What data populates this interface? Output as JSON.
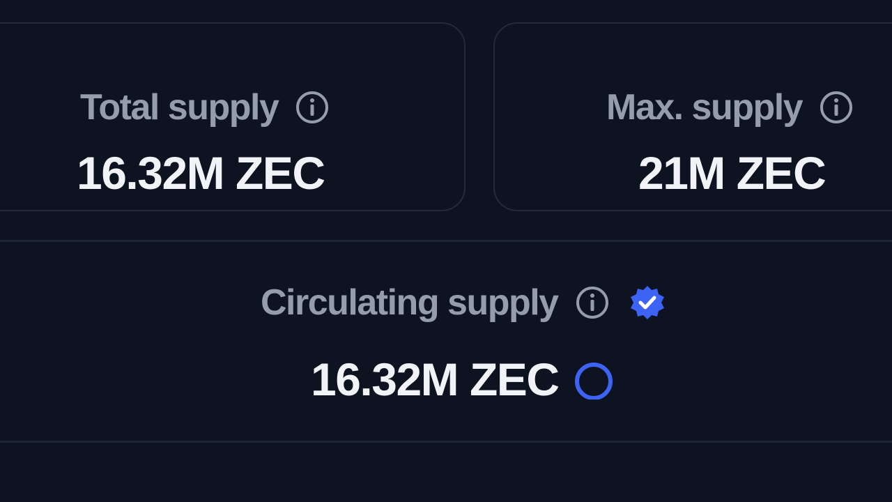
{
  "supply_cards": {
    "total": {
      "label": "Total supply",
      "value": "16.32M ZEC",
      "info_icon": "info-icon"
    },
    "max": {
      "label": "Max. supply",
      "value": "21M ZEC",
      "info_icon": "info-icon"
    }
  },
  "circulating": {
    "label": "Circulating supply",
    "value": "16.32M ZEC",
    "info_icon": "info-icon",
    "verified_icon": "verified-badge-icon",
    "status_icon": "loading-ring-icon"
  },
  "colors": {
    "background": "#0d1321",
    "card_border": "#232b3b",
    "label": "#959cab",
    "value": "#f1f3f6",
    "accent": "#3d63f5"
  }
}
